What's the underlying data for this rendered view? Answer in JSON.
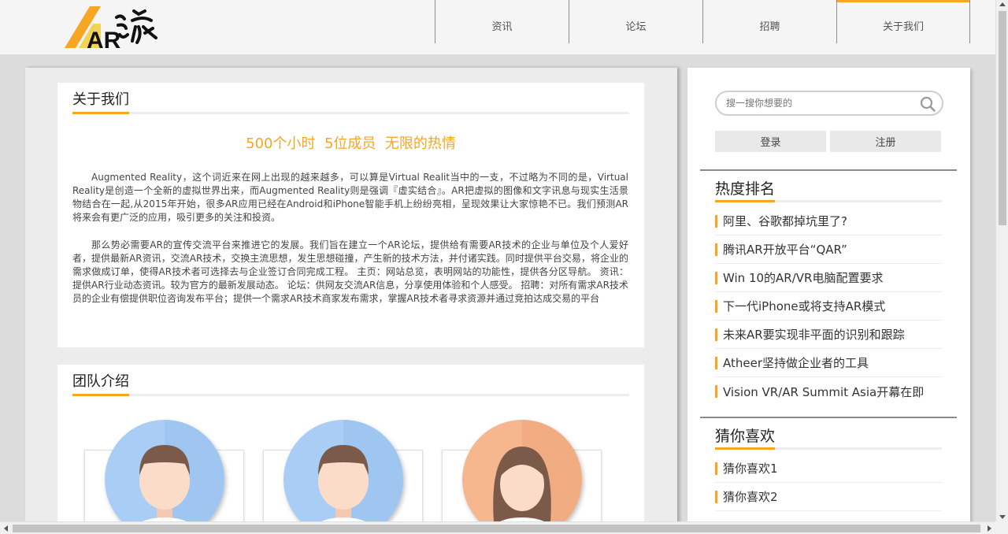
{
  "logo": {
    "text": "AR",
    "alt": "AR谷家"
  },
  "nav": {
    "items": [
      {
        "label": "资讯"
      },
      {
        "label": "论坛"
      },
      {
        "label": "招聘"
      },
      {
        "label": "关于我们",
        "active": true
      }
    ]
  },
  "about": {
    "title": "关于我们",
    "slogan": "500个小时  5位成员  无限的热情",
    "paragraphs": [
      "Augmented Reality，这个词近来在网上出现的越来越多，可以算是Virtual Realit当中的一支，不过略为不同的是，Virtual Reality是创造一个全新的虚拟世界出来，而Augmented Reality则是强调『虚实结合』。AR把虚拟的图像和文字讯息与现实生活景物结合在一起,从2015年开始，很多AR应用已经在Android和iPhone智能手机上纷纷亮相，呈现效果让大家惊艳不已。我们预测AR将来会有更广泛的应用，吸引更多的关注和投资。",
      "那么势必需要AR的宣传交流平台来推进它的发展。我们旨在建立一个AR论坛，提供给有需要AR技术的企业与单位及个人爱好者，提供最新AR资讯，交流AR技术，交换主流思想，发生思想碰撞，产生新的技术方法，并付诸实践。同时提供平台交易，将企业的需求做成订单，使得AR技术者可选择去与企业签订合同完成工程。 主页：网站总览，表明网站的功能性，提供各分区导航。 资讯：提供AR行业动态资讯。较为官方的最新发展动态。 论坛：供网友交流AR信息，分享使用体验和个人感受。 招聘：对所有需求AR技术员的企业有偿提供职位咨询发布平台；提供一个需求AR技术商家发布需求，掌握AR技术者寻求资源并通过竞拍达成交易的平台"
    ]
  },
  "team": {
    "title": "团队介绍",
    "members": [
      {
        "avatar": "male-avatar-icon",
        "bg": "#a9cdf5"
      },
      {
        "avatar": "male-avatar-icon",
        "bg": "#a9cdf5"
      },
      {
        "avatar": "female-avatar-icon",
        "bg": "#f6b78f"
      }
    ]
  },
  "sidebar": {
    "search": {
      "placeholder": "搜一搜你想要的",
      "icon": "search-icon"
    },
    "login_label": "登录",
    "register_label": "注册",
    "hot": {
      "title": "热度排名",
      "items": [
        "阿里、谷歌都掉坑里了?",
        "腾讯AR开放平台“QAR”",
        "Win 10的AR/VR电脑配置要求",
        "下一代iPhone或将支持AR模式",
        "未来AR要实现非平面的识别和跟踪",
        "Atheer坚持做企业者的工具",
        "Vision VR/AR Summit Asia开幕在即"
      ]
    },
    "guess": {
      "title": "猜你喜欢",
      "items": [
        "猜你喜欢1",
        "猜你喜欢2"
      ]
    }
  },
  "colors": {
    "accent": "#f6a623",
    "background": "#dcdcdc"
  }
}
